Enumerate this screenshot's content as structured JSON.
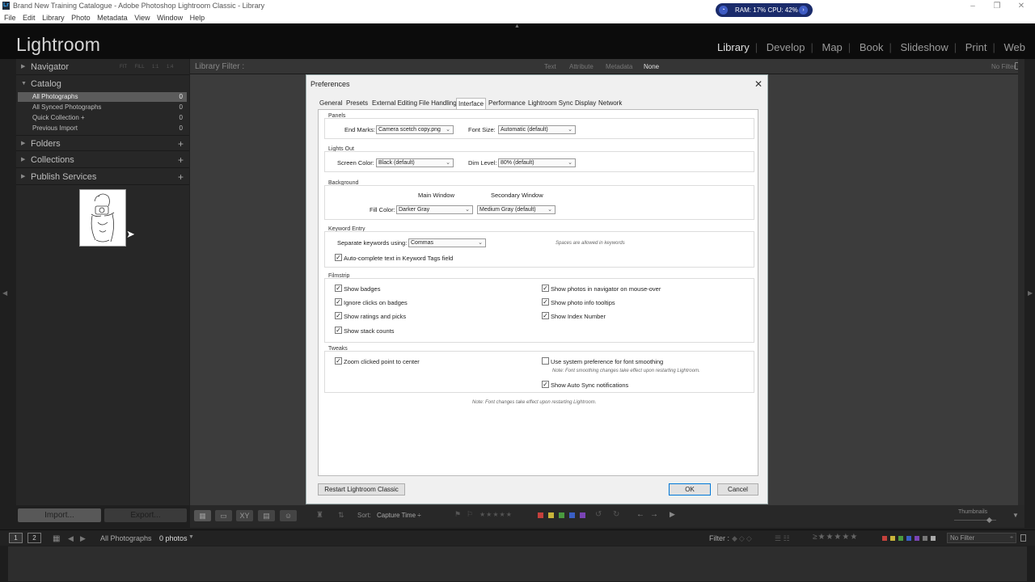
{
  "window": {
    "title": "Brand New Training Catalogue - Adobe Photoshop Lightroom Classic - Library",
    "app_icon": "Lr"
  },
  "sysmon": {
    "text": "RAM: 17% CPU: 42%"
  },
  "menu": [
    "File",
    "Edit",
    "Library",
    "Photo",
    "Metadata",
    "View",
    "Window",
    "Help"
  ],
  "header": {
    "logo": "Lightroom",
    "modules": [
      "Library",
      "Develop",
      "Map",
      "Book",
      "Slideshow",
      "Print",
      "Web"
    ],
    "active_module": "Library"
  },
  "left_panel": {
    "navigator": {
      "label": "Navigator",
      "zoom_options": [
        "FIT",
        "FILL",
        "1:1",
        "1:4"
      ]
    },
    "catalog": {
      "label": "Catalog",
      "items": [
        {
          "label": "All Photographs",
          "count": "0"
        },
        {
          "label": "All Synced Photographs",
          "count": "0"
        },
        {
          "label": "Quick Collection +",
          "count": "0"
        },
        {
          "label": "Previous Import",
          "count": "0"
        }
      ]
    },
    "folders": {
      "label": "Folders"
    },
    "collections": {
      "label": "Collections"
    },
    "publish": {
      "label": "Publish Services"
    },
    "import_label": "Import...",
    "export_label": "Export..."
  },
  "library_filter": {
    "label": "Library Filter :",
    "options": [
      "Text",
      "Attribute",
      "Metadata",
      "None"
    ],
    "active": "None",
    "preset": "No Filter ÷"
  },
  "toolbar": {
    "sort_label": "Sort:",
    "sort_value": "Capture Time ÷",
    "thumbnails_label": "Thumbnails"
  },
  "filmbar": {
    "tab1": "1",
    "tab2": "2",
    "source": "All Photographs",
    "count": "0 photos",
    "filter_label": "Filter :",
    "filter_value": "No Filter"
  },
  "dialog": {
    "title": "Preferences",
    "tabs": [
      "General",
      "Presets",
      "External Editing",
      "File Handling",
      "Interface",
      "Performance",
      "Lightroom Sync",
      "Display",
      "Network"
    ],
    "active_tab": "Interface",
    "panels": {
      "label": "Panels",
      "end_marks_label": "End Marks:",
      "end_marks_value": "Camera scetch copy.png",
      "font_size_label": "Font Size:",
      "font_size_value": "Automatic (default)"
    },
    "lights_out": {
      "label": "Lights Out",
      "screen_color_label": "Screen Color:",
      "screen_color_value": "Black (default)",
      "dim_level_label": "Dim Level:",
      "dim_level_value": "80% (default)"
    },
    "background": {
      "label": "Background",
      "main_window": "Main Window",
      "secondary_window": "Secondary Window",
      "fill_color_label": "Fill Color:",
      "main_value": "Darker Gray",
      "secondary_value": "Medium Gray (default)"
    },
    "keyword_entry": {
      "label": "Keyword Entry",
      "separate_label": "Separate keywords using:",
      "separate_value": "Commas",
      "spaces_note": "Spaces are allowed in keywords",
      "autocomplete_label": "Auto-complete text in Keyword Tags field",
      "autocomplete_checked": true
    },
    "filmstrip": {
      "label": "Filmstrip",
      "left": [
        {
          "label": "Show badges",
          "checked": true
        },
        {
          "label": "Ignore clicks on badges",
          "checked": true
        },
        {
          "label": "Show ratings and picks",
          "checked": true
        },
        {
          "label": "Show stack counts",
          "checked": true
        }
      ],
      "right": [
        {
          "label": "Show photos in navigator on mouse-over",
          "checked": true
        },
        {
          "label": "Show photo info tooltips",
          "checked": true
        },
        {
          "label": "Show Index Number",
          "checked": true
        }
      ]
    },
    "tweaks": {
      "label": "Tweaks",
      "zoom_label": "Zoom clicked point to center",
      "zoom_checked": true,
      "font_smoothing_label": "Use system preference for font smoothing",
      "font_smoothing_checked": false,
      "font_smoothing_note": "Note: Font smoothing changes take effect upon restarting Lightroom.",
      "autosync_label": "Show Auto Sync notifications",
      "autosync_checked": true
    },
    "footer_note": "Note: Font changes take effect upon restarting Lightroom.",
    "restart_label": "Restart Lightroom Classic",
    "ok_label": "OK",
    "cancel_label": "Cancel"
  },
  "colors": {
    "accent_blue": "#0078d7",
    "label_red": "#c4413c",
    "label_yellow": "#c9b43a",
    "label_green": "#4a9a3f",
    "label_blue": "#3a5fc4",
    "label_purple": "#7a44b5"
  }
}
